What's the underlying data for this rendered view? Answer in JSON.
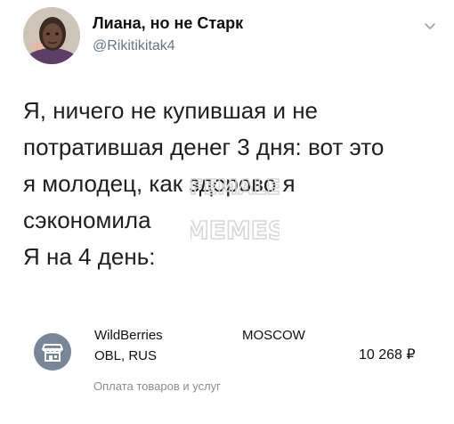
{
  "tweet": {
    "author_name": "Лиана, но не Старк",
    "author_handle": "@Rikitikitak4",
    "text_main": "Я, ничего не купившая и не\nпотратившая денег 3 дня: вот это\nя молодец, как здорово я\nсэкономила",
    "text_followup": "Я на 4 день:"
  },
  "watermark": {
    "line1": "FEMALE",
    "line2": "MEMES"
  },
  "receipt": {
    "merchant": "WildBerries",
    "city": "MOSCOW",
    "location": "OBL,  RUS",
    "amount": "10 268 ₽",
    "category": "Оплата товаров и услуг"
  },
  "icons": {
    "chevron": "chevron-down-icon",
    "shop": "shop-icon"
  }
}
